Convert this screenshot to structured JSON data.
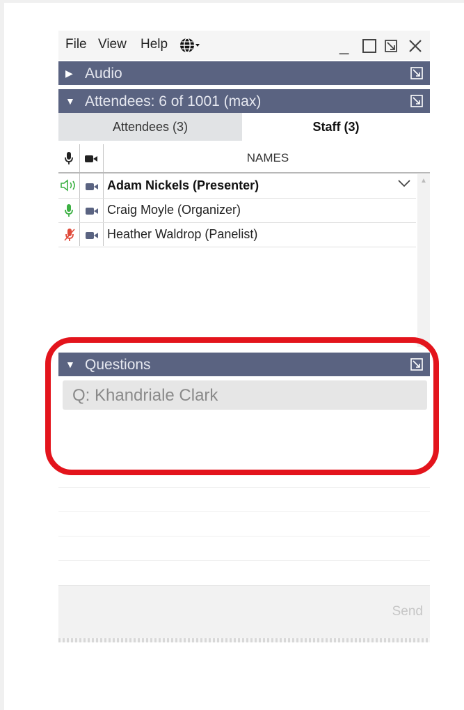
{
  "menu": {
    "items": [
      "File",
      "View",
      "Help"
    ],
    "globe_icon": "globe-icon"
  },
  "window_controls": {
    "minimize": "_",
    "restore": "☐",
    "popout": "⧉",
    "close": "✕"
  },
  "audio_section": {
    "title": "Audio",
    "collapsed": true
  },
  "attendees_section": {
    "title": "Attendees:  6 of 1001 (max)",
    "collapsed": false
  },
  "tabs": [
    {
      "label": "Attendees (3)",
      "active": false
    },
    {
      "label": "Staff (3)",
      "active": true
    }
  ],
  "names_table": {
    "header": "NAMES",
    "rows": [
      {
        "name": "Adam Nickels (Presenter)",
        "bold": true,
        "mic_status": "speaking",
        "camera_icon": "camera-icon"
      },
      {
        "name": "Craig Moyle (Organizer)",
        "bold": false,
        "mic_status": "unmuted",
        "camera_icon": "camera-icon"
      },
      {
        "name": "Heather Waldrop (Panelist)",
        "bold": false,
        "mic_status": "muted",
        "camera_icon": "camera-icon"
      }
    ]
  },
  "questions_section": {
    "title": "Questions",
    "items": [
      "Q: Khandriale Clark"
    ]
  },
  "compose": {
    "send_label": "Send"
  },
  "colors": {
    "header_bar": "#5a6381",
    "speaking_green": "#3cb043",
    "muted_red": "#e04a3a",
    "camera_blue": "#5a6381",
    "highlight_red": "#e3141c"
  }
}
